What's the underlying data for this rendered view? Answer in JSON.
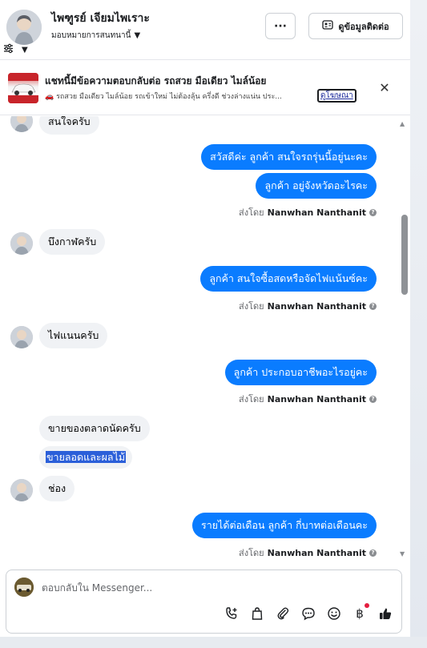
{
  "header": {
    "contact_name": "ไพฑูรย์ เจียมไพเราะ",
    "assign_label": "มอบหมายการสนทนานี้",
    "more_label": "···",
    "contact_info_label": "ดูข้อมูลติดต่อ"
  },
  "ad": {
    "title": "แชทนี้มีข้อความตอบกลับต่อ รถสวย มือเดียว ไมล์น้อย",
    "description": "🚗 รถสวย มือเดียว ไมล์น้อย รถเข้าใหม่ ไม่ต้องลุ้น ครึ่งดี ช่วงล่างแน่น ประ...",
    "link": "ดูโฆษณา",
    "close": "✕"
  },
  "messages": [
    {
      "dir": "in",
      "text": "สนใจครับ"
    },
    {
      "dir": "out",
      "text": "สวัสดีค่ะ  ลูกค้า สนใจรถรุ่นนี้อยู่นะคะ"
    },
    {
      "dir": "out",
      "text": "ลูกค้า อยู่จังหวัดอะไรคะ"
    },
    {
      "dir": "in",
      "text": "บึงกาฬครับ"
    },
    {
      "dir": "out",
      "text": "ลูกค้า สนใจซื้อสดหรือจัดไฟแน้นซ์คะ"
    },
    {
      "dir": "in",
      "text": "ไฟแนนครับ"
    },
    {
      "dir": "out",
      "text": "ลูกค้า ประกอบอาชีพอะไรอยู่คะ"
    },
    {
      "dir": "in",
      "text": "ขายของตลาดนัดครับ"
    },
    {
      "dir": "in",
      "text": "ขายลอดและผลไม้"
    },
    {
      "dir": "in",
      "text": "ช่อง"
    },
    {
      "dir": "out",
      "text": "รายได้ต่อเดือน ลูกค้า กี่บาทต่อเดือนคะ"
    }
  ],
  "sent_by": {
    "prefix": "ส่งโดย",
    "name": "Nanwhan Nanthanit"
  },
  "composer": {
    "placeholder": "ตอบกลับใน Messenger..."
  },
  "toolbar": {
    "icons": [
      "phone-add-icon",
      "shopping-bag-icon",
      "paperclip-icon",
      "chat-bubble-icon",
      "emoji-icon",
      "baht-icon",
      "thumbs-up-icon"
    ],
    "baht_symbol": "฿"
  },
  "colors": {
    "outgoing_bubble": "#0a7cff",
    "incoming_bubble": "#f0f2f5",
    "notification_dot": "#e41e3f"
  }
}
